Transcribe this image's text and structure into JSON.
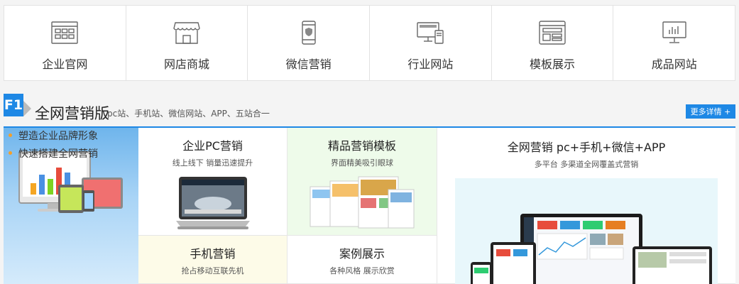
{
  "topnav": {
    "items": [
      {
        "label": "企业官网",
        "icon": "website-grid-icon"
      },
      {
        "label": "网店商城",
        "icon": "shop-awning-icon"
      },
      {
        "label": "微信营销",
        "icon": "mobile-shield-icon"
      },
      {
        "label": "行业网站",
        "icon": "devices-icon"
      },
      {
        "label": "模板展示",
        "icon": "template-layout-icon"
      },
      {
        "label": "成品网站",
        "icon": "monitor-chart-icon"
      }
    ]
  },
  "section": {
    "badge": "F1",
    "title": "全网营销版",
    "subtitle": "pc站、手机站、微信网站、APP、五站合一",
    "more_label": "更多详情 +",
    "accent_color": "#1e88e5"
  },
  "left_panel": {
    "features": [
      "塑造企业品牌形象",
      "快速搭建全网营销"
    ]
  },
  "cards": {
    "pc": {
      "title": "企业PC营销",
      "subtitle": "线上线下 销量迅速提升"
    },
    "template": {
      "title": "精品营销模板",
      "subtitle": "界面精美吸引眼球"
    },
    "mobile": {
      "title": "手机营销",
      "subtitle": "抢占移动互联先机"
    },
    "cases": {
      "title": "案例展示",
      "subtitle": "各种风格 展示欣赏"
    },
    "allnet": {
      "title": "全网营销 pc+手机+微信+APP",
      "subtitle": "多平台 多渠道全网覆盖式营销"
    }
  }
}
